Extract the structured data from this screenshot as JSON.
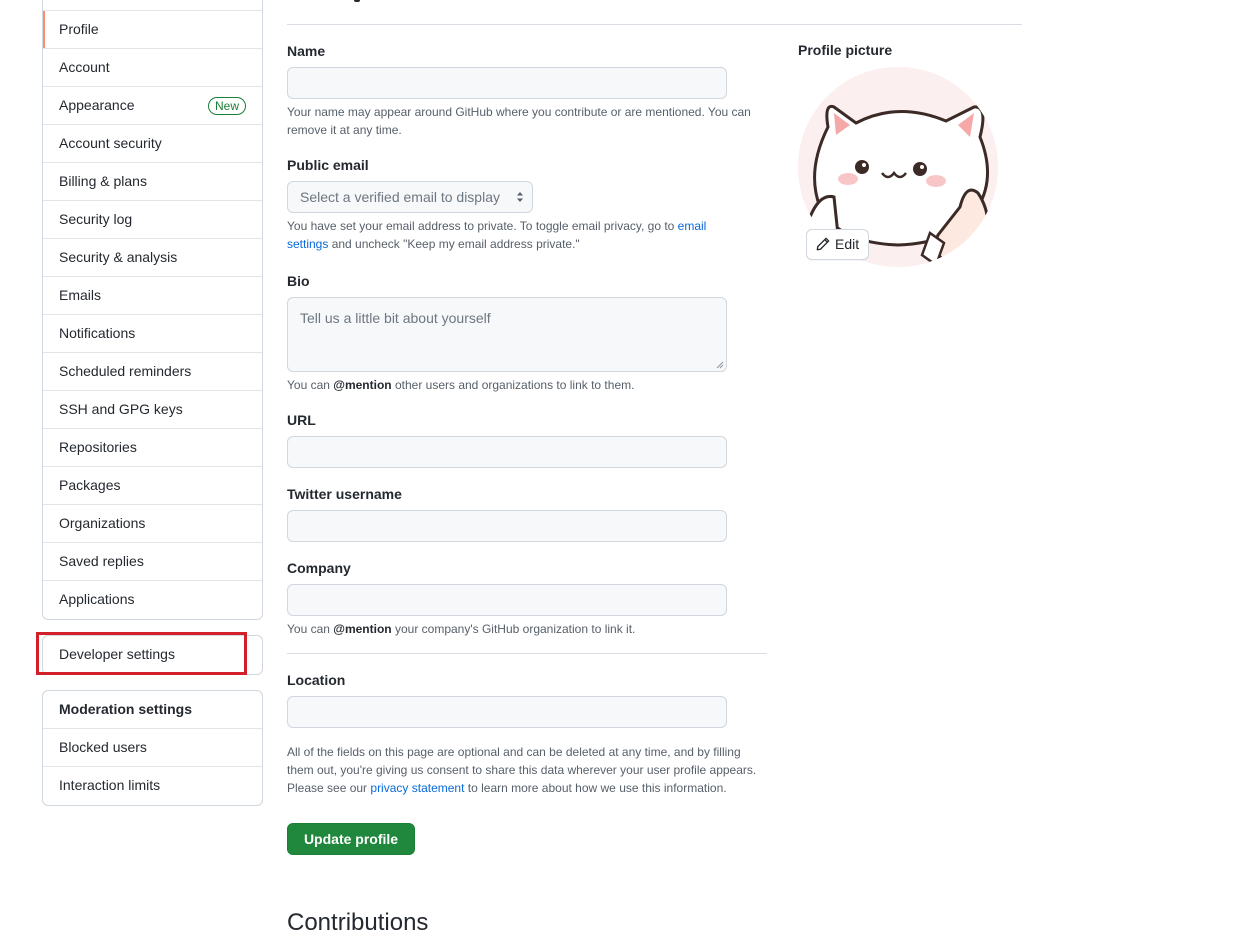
{
  "sidebar": {
    "main_items": [
      {
        "label": "Profile"
      },
      {
        "label": "Account"
      },
      {
        "label": "Appearance",
        "badge": "New"
      },
      {
        "label": "Account security"
      },
      {
        "label": "Billing & plans"
      },
      {
        "label": "Security log"
      },
      {
        "label": "Security & analysis"
      },
      {
        "label": "Emails"
      },
      {
        "label": "Notifications"
      },
      {
        "label": "Scheduled reminders"
      },
      {
        "label": "SSH and GPG keys"
      },
      {
        "label": "Repositories"
      },
      {
        "label": "Packages"
      },
      {
        "label": "Organizations"
      },
      {
        "label": "Saved replies"
      },
      {
        "label": "Applications"
      }
    ],
    "developer_settings": "Developer settings",
    "moderation": {
      "heading": "Moderation settings",
      "items": [
        {
          "label": "Blocked users"
        },
        {
          "label": "Interaction limits"
        }
      ]
    },
    "selected": "Profile"
  },
  "form": {
    "name": {
      "label": "Name",
      "value": "",
      "note": "Your name may appear around GitHub where you contribute or are mentioned. You can remove it at any time."
    },
    "public_email": {
      "label": "Public email",
      "placeholder": "Select a verified email to display",
      "note_before": "You have set your email address to private. To toggle email privacy, go to ",
      "note_link": "email settings",
      "note_after": " and uncheck \"Keep my email address private.\""
    },
    "bio": {
      "label": "Bio",
      "placeholder": "Tell us a little bit about yourself",
      "note_before": "You can ",
      "note_bold": "@mention",
      "note_after": " other users and organizations to link to them."
    },
    "url": {
      "label": "URL",
      "value": ""
    },
    "twitter": {
      "label": "Twitter username",
      "value": ""
    },
    "company": {
      "label": "Company",
      "value": "",
      "note_before": "You can ",
      "note_bold": "@mention",
      "note_after": " your company's GitHub organization to link it."
    },
    "location": {
      "label": "Location",
      "value": ""
    },
    "disclaimer": {
      "before": "All of the fields on this page are optional and can be deleted at any time, and by filling them out, you're giving us consent to share this data wherever your user profile appears. Please see our ",
      "link": "privacy statement",
      "after": " to learn more about how we use this information."
    },
    "submit_label": "Update profile"
  },
  "profile_picture": {
    "label": "Profile picture",
    "edit_label": "Edit"
  },
  "contributions_heading": "Contributions",
  "colors": {
    "accent_selected": "#fd8c73",
    "primary_button": "#1f883d",
    "link": "#0969da",
    "highlight": "#d1202a",
    "badge": "#1a7f37"
  }
}
